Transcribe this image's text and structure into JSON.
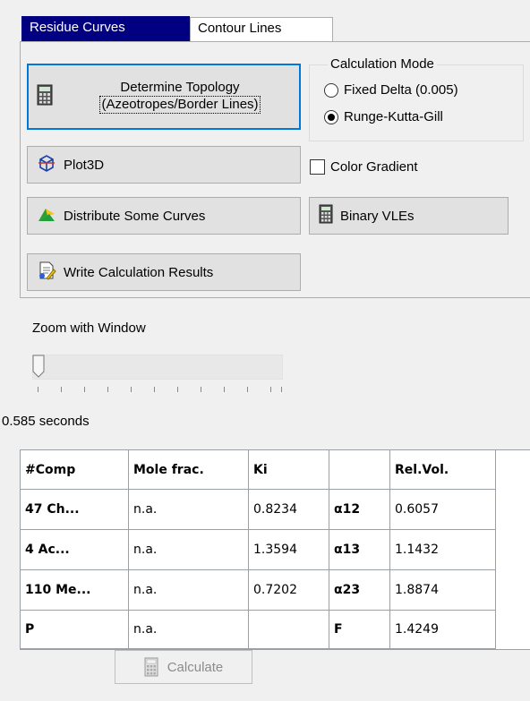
{
  "tabs": [
    {
      "label": "Residue Curves",
      "active": true
    },
    {
      "label": "Contour Lines",
      "active": false
    }
  ],
  "buttons": {
    "topology_line1": "Determine Topology",
    "topology_line2": "(Azeotropes/Border Lines)",
    "plot3d": "Plot3D",
    "distribute": "Distribute Some Curves",
    "write_results": "Write Calculation Results",
    "binary_vles": "Binary VLEs",
    "calculate": "Calculate"
  },
  "calculation_mode": {
    "legend": "Calculation Mode",
    "options": [
      {
        "label": "Fixed Delta (0.005)",
        "selected": false
      },
      {
        "label": "Runge-Kutta-Gill",
        "selected": true
      }
    ]
  },
  "color_gradient": {
    "label": "Color Gradient",
    "checked": false
  },
  "zoom": {
    "label": "Zoom with Window",
    "value": 0
  },
  "timing": "0.585 seconds",
  "table": {
    "headers": [
      "#Comp",
      "Mole frac.",
      "Ki",
      "",
      "Rel.Vol."
    ],
    "rows": [
      [
        "47 Ch...",
        "n.a.",
        "0.8234",
        "α12",
        "0.6057"
      ],
      [
        "4 Ac...",
        "n.a.",
        "1.3594",
        "α13",
        "1.1432"
      ],
      [
        "110 Me...",
        "n.a.",
        "0.7202",
        "α23",
        "1.8874"
      ],
      [
        "P",
        "n.a.",
        "",
        "F",
        "1.4249"
      ]
    ]
  },
  "colors": {
    "active_tab": "#000080",
    "button_face": "#e1e1e1",
    "focus_border": "#0078d7"
  }
}
